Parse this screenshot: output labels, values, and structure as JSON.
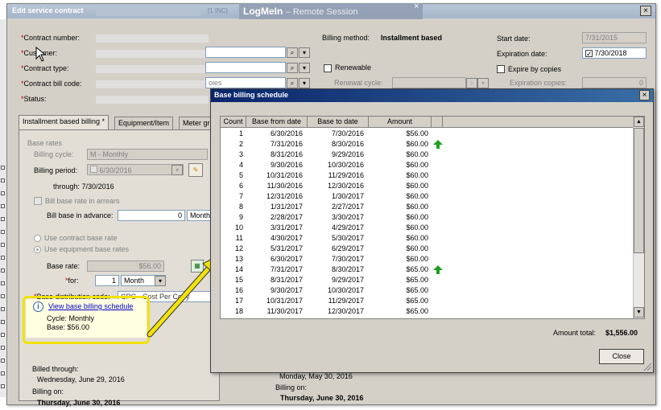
{
  "main_window": {
    "title": "Edit service contract",
    "title_tag": "[1 INC]",
    "close_label": "×"
  },
  "logmein": {
    "brand": "LogMeIn",
    "subtitle": "– Remote Session",
    "close_label": "×"
  },
  "form": {
    "contract_number_label": "Contract number:",
    "customer_label": "Customer:",
    "contract_type_label": "Contract type:",
    "contract_bill_code_label": "Contract bill code:",
    "status_label": "Status:",
    "required_mark": "*",
    "billing_method_label": "Billing method:",
    "billing_method_value": "Installment based",
    "renewable_label": "Renewable",
    "renewal_cycle_label": "Renewal cycle:",
    "renewal_partial": "oies",
    "start_date_label": "Start date:",
    "start_date_value": "7/31/2015",
    "expiration_date_label": "Expiration date:",
    "expiration_date_value": "7/30/2018",
    "expiration_checked": "✓",
    "expire_by_copies_label": "Expire by copies",
    "expiration_copies_label": "Expiration copies:",
    "expiration_copies_value": "0",
    "lookup_icon": "⌕",
    "dropdown_icon": "▾"
  },
  "tabs": [
    {
      "label": "Installment based billing *"
    },
    {
      "label": "Equipment/Item"
    },
    {
      "label": "Meter gr"
    }
  ],
  "panel": {
    "base_rates_title": "Base rates",
    "billing_cycle_label": "Billing cycle:",
    "billing_cycle_value": "M - Monthly",
    "billing_period_label": "Billing period:",
    "billing_period_value": "6/30/2016",
    "through_label": "through:",
    "through_value": "7/30/2016",
    "bill_in_arrears_label": "Bill base rate in arrears",
    "bill_in_advance_label": "Bill base in advance:",
    "bill_in_advance_value": "0",
    "bill_in_advance_unit": "Month",
    "use_contract_rates_label": "Use contract base rate",
    "use_equipment_rates_label": "Use equipment base rates",
    "base_rate_label": "Base rate:",
    "base_rate_value": "$56.00",
    "for_label": "for:",
    "for_value": "1",
    "for_unit": "Month",
    "distribution_code_label": "Base distribution code:",
    "distribution_code_value": "CPC - Cost Per Copy",
    "info_link": "View base billing schedule",
    "info_cycle": "Cycle: Monthly",
    "info_base": "Base: $56.00",
    "billed_through_label": "Billed through:",
    "billed_through_value": "Wednesday, June 29, 2016",
    "billing_on_label": "Billing on:",
    "billing_on_value": "Thursday, June 30, 2016",
    "right_billed_through_value": "Monday, May 30, 2016",
    "right_billing_on_label": "Billing on:",
    "right_billing_on_value": "Thursday, June 30, 2016"
  },
  "dialog": {
    "title": "Base billing schedule",
    "close_label": "×",
    "columns": [
      "Count",
      "Base from date",
      "Base to date",
      "Amount"
    ],
    "rows": [
      {
        "count": "1",
        "from": "6/30/2016",
        "to": "7/30/2016",
        "amount": "$56.00",
        "increase": false
      },
      {
        "count": "2",
        "from": "7/31/2016",
        "to": "8/30/2016",
        "amount": "$60.00",
        "increase": true
      },
      {
        "count": "3",
        "from": "8/31/2016",
        "to": "9/29/2016",
        "amount": "$60.00",
        "increase": false
      },
      {
        "count": "4",
        "from": "9/30/2016",
        "to": "10/30/2016",
        "amount": "$60.00",
        "increase": false
      },
      {
        "count": "5",
        "from": "10/31/2016",
        "to": "11/29/2016",
        "amount": "$60.00",
        "increase": false
      },
      {
        "count": "6",
        "from": "11/30/2016",
        "to": "12/30/2016",
        "amount": "$60.00",
        "increase": false
      },
      {
        "count": "7",
        "from": "12/31/2016",
        "to": "1/30/2017",
        "amount": "$60.00",
        "increase": false
      },
      {
        "count": "8",
        "from": "1/31/2017",
        "to": "2/27/2017",
        "amount": "$60.00",
        "increase": false
      },
      {
        "count": "9",
        "from": "2/28/2017",
        "to": "3/30/2017",
        "amount": "$60.00",
        "increase": false
      },
      {
        "count": "10",
        "from": "3/31/2017",
        "to": "4/29/2017",
        "amount": "$60.00",
        "increase": false
      },
      {
        "count": "11",
        "from": "4/30/2017",
        "to": "5/30/2017",
        "amount": "$60.00",
        "increase": false
      },
      {
        "count": "12",
        "from": "5/31/2017",
        "to": "6/29/2017",
        "amount": "$60.00",
        "increase": false
      },
      {
        "count": "13",
        "from": "6/30/2017",
        "to": "7/30/2017",
        "amount": "$60.00",
        "increase": false
      },
      {
        "count": "14",
        "from": "7/31/2017",
        "to": "8/30/2017",
        "amount": "$65.00",
        "increase": true
      },
      {
        "count": "15",
        "from": "8/31/2017",
        "to": "9/29/2017",
        "amount": "$65.00",
        "increase": false
      },
      {
        "count": "16",
        "from": "9/30/2017",
        "to": "10/30/2017",
        "amount": "$65.00",
        "increase": false
      },
      {
        "count": "17",
        "from": "10/31/2017",
        "to": "11/29/2017",
        "amount": "$65.00",
        "increase": false
      },
      {
        "count": "18",
        "from": "11/30/2017",
        "to": "12/30/2017",
        "amount": "$65.00",
        "increase": false
      }
    ],
    "amount_total_label": "Amount total:",
    "amount_total_value": "$1,556.00",
    "close_button": "Close"
  },
  "colors": {
    "highlight": "#f2e20a",
    "increase_arrow": "#1fa01f",
    "dialog_title": "#0a246a",
    "required": "#c00000"
  }
}
